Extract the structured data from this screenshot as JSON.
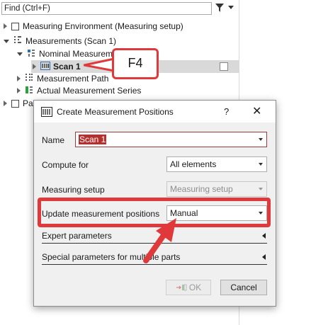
{
  "search": {
    "placeholder": "Find (Ctrl+F)"
  },
  "tree": {
    "measuring_environment": "Measuring Environment (Measuring setup)",
    "measurements": "Measurements (Scan 1)",
    "nominal": "Nominal Measurement",
    "scan": "Scan 1",
    "path": "Measurement Path",
    "actual": "Actual Measurement Series",
    "part_prefix": "Pa"
  },
  "callout": {
    "key": "F4"
  },
  "dialog": {
    "title": "Create Measurement Positions",
    "help": "?",
    "close": "✕",
    "name_label": "Name",
    "name_value": "Scan 1",
    "compute_label": "Compute for",
    "compute_value": "All elements",
    "setup_label": "Measuring setup",
    "setup_value": "Measuring setup",
    "update_label": "Update measurement positions",
    "update_value": "Manual",
    "expert_label": "Expert parameters",
    "special_label": "Special parameters for multiple parts",
    "ok_label": "OK",
    "cancel_label": "Cancel"
  },
  "colors": {
    "highlight": "#e0393b",
    "accent": "#b2312e"
  }
}
